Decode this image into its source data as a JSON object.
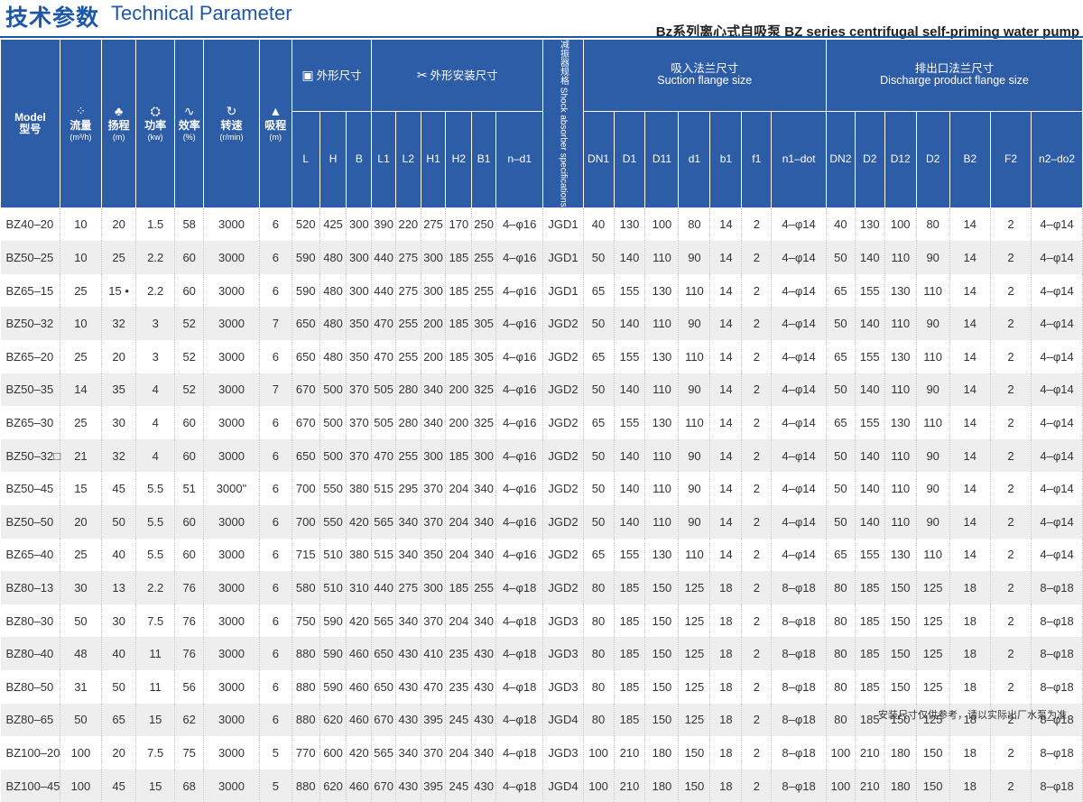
{
  "header": {
    "title_cn": "技术参数",
    "title_en": "Technical Parameter",
    "subtitle": "Bz系列离心式自吸泵 BZ series centrifugal self-priming water pump"
  },
  "table": {
    "model": {
      "en": "Model",
      "cn": "型号"
    },
    "cols_main": [
      {
        "cn": "流量",
        "unit": "(m³/h)",
        "icon": "drops-icon"
      },
      {
        "cn": "扬程",
        "unit": "(m)",
        "icon": "pump-icon"
      },
      {
        "cn": "功率",
        "unit": "(kw)",
        "icon": "motor-icon"
      },
      {
        "cn": "效率",
        "unit": "(%)",
        "icon": "wave-icon"
      },
      {
        "cn": "转速",
        "unit": "(r/min)",
        "icon": "rotate-icon"
      },
      {
        "cn": "吸程",
        "unit": "(m)",
        "icon": "suction-icon"
      }
    ],
    "group_dim": "外形尺寸",
    "group_install": "外形安装尺寸",
    "shock_absorber": "减振器规格 Shock absorber specifications",
    "suction_cn": "吸入法兰尺寸",
    "suction_en": "Suction flange size",
    "discharge_cn": "排出口法兰尺寸",
    "discharge_en": "Discharge product flange size",
    "sub_dim": [
      "L",
      "H",
      "B"
    ],
    "sub_install": [
      "L1",
      "L2",
      "H1",
      "H2",
      "B1",
      "n–d1"
    ],
    "sub_suction": [
      "DN1",
      "D1",
      "D11",
      "d1",
      "b1",
      "f1",
      "n1–dot"
    ],
    "sub_discharge": [
      "DN2",
      "D2",
      "D12",
      "D2",
      "B2",
      "F2",
      "n2–do2"
    ],
    "rows": [
      [
        "BZ40–20",
        "10",
        "20",
        "1.5",
        "58",
        "3000",
        "6",
        "520",
        "425",
        "300",
        "390",
        "220",
        "275",
        "170",
        "250",
        "4–φ16",
        "JGD1",
        "40",
        "130",
        "100",
        "80",
        "14",
        "2",
        "4–φ14",
        "40",
        "130",
        "100",
        "80",
        "14",
        "2",
        "4–φ14"
      ],
      [
        "BZ50–25",
        "10",
        "25",
        "2.2",
        "60",
        "3000",
        "6",
        "590",
        "480",
        "300",
        "440",
        "275",
        "300",
        "185",
        "255",
        "4–φ16",
        "JGD1",
        "50",
        "140",
        "110",
        "90",
        "14",
        "2",
        "4–φ14",
        "50",
        "140",
        "110",
        "90",
        "14",
        "2",
        "4–φ14"
      ],
      [
        "BZ65–15",
        "25",
        "15 •",
        "2.2",
        "60",
        "3000",
        "6",
        "590",
        "480",
        "300",
        "440",
        "275",
        "300",
        "185",
        "255",
        "4–φ16",
        "JGD1",
        "65",
        "155",
        "130",
        "110",
        "14",
        "2",
        "4–φ14",
        "65",
        "155",
        "130",
        "110",
        "14",
        "2",
        "4–φ14"
      ],
      [
        "BZ50–32",
        "10",
        "32",
        "3",
        "52",
        "3000",
        "7",
        "650",
        "480",
        "350",
        "470",
        "255",
        "200",
        "185",
        "305",
        "4–φ16",
        "JGD2",
        "50",
        "140",
        "110",
        "90",
        "14",
        "2",
        "4–φ14",
        "50",
        "140",
        "110",
        "90",
        "14",
        "2",
        "4–φ14"
      ],
      [
        "BZ65–20",
        "25",
        "20",
        "3",
        "52",
        "3000",
        "6",
        "650",
        "480",
        "350",
        "470",
        "255",
        "200",
        "185",
        "305",
        "4–φ16",
        "JGD2",
        "65",
        "155",
        "130",
        "110",
        "14",
        "2",
        "4–φ14",
        "65",
        "155",
        "130",
        "110",
        "14",
        "2",
        "4–φ14"
      ],
      [
        "BZ50–35",
        "14",
        "35",
        "4",
        "52",
        "3000",
        "7",
        "670",
        "500",
        "370",
        "505",
        "280",
        "340",
        "200",
        "325",
        "4–φ16",
        "JGD2",
        "50",
        "140",
        "110",
        "90",
        "14",
        "2",
        "4–φ14",
        "50",
        "140",
        "110",
        "90",
        "14",
        "2",
        "4–φ14"
      ],
      [
        "BZ65–30",
        "25",
        "30",
        "4",
        "60",
        "3000",
        "6",
        "670",
        "500",
        "370",
        "505",
        "280",
        "340",
        "200",
        "325",
        "4–φ16",
        "JGD2",
        "65",
        "155",
        "130",
        "110",
        "14",
        "2",
        "4–φ14",
        "65",
        "155",
        "130",
        "110",
        "14",
        "2",
        "4–φ14"
      ],
      [
        "BZ50–32□",
        "21",
        "32",
        "4",
        "60",
        "3000",
        "6",
        "650",
        "500",
        "370",
        "470",
        "255",
        "300",
        "185",
        "300",
        "4–φ16",
        "JGD2",
        "50",
        "140",
        "110",
        "90",
        "14",
        "2",
        "4–φ14",
        "50",
        "140",
        "110",
        "90",
        "14",
        "2",
        "4–φ14"
      ],
      [
        "BZ50–45",
        "15",
        "45",
        "5.5",
        "51",
        "3000\"",
        "6",
        "700",
        "550",
        "380",
        "515",
        "295",
        "370",
        "204",
        "340",
        "4–φ16",
        "JGD2",
        "50",
        "140",
        "110",
        "90",
        "14",
        "2",
        "4–φ14",
        "50",
        "140",
        "110",
        "90",
        "14",
        "2",
        "4–φ14"
      ],
      [
        "BZ50–50",
        "20",
        "50",
        "5.5",
        "60",
        "3000",
        "6",
        "700",
        "550",
        "420",
        "565",
        "340",
        "370",
        "204",
        "340",
        "4–φ16",
        "JGD2",
        "50",
        "140",
        "110",
        "90",
        "14",
        "2",
        "4–φ14",
        "50",
        "140",
        "110",
        "90",
        "14",
        "2",
        "4–φ14"
      ],
      [
        "BZ65–40",
        "25",
        "40",
        "5.5",
        "60",
        "3000",
        "6",
        "715",
        "510",
        "380",
        "515",
        "340",
        "350",
        "204",
        "340",
        "4–φ16",
        "JGD2",
        "65",
        "155",
        "130",
        "110",
        "14",
        "2",
        "4–φ14",
        "65",
        "155",
        "130",
        "110",
        "14",
        "2",
        "4–φ14"
      ],
      [
        "BZ80–13",
        "30",
        "13",
        "2.2",
        "76",
        "3000",
        "6",
        "580",
        "510",
        "310",
        "440",
        "275",
        "300",
        "185",
        "255",
        "4–φ18",
        "JGD2",
        "80",
        "185",
        "150",
        "125",
        "18",
        "2",
        "8–φ18",
        "80",
        "185",
        "150",
        "125",
        "18",
        "2",
        "8–φ18"
      ],
      [
        "BZ80–30",
        "50",
        "30",
        "7.5",
        "76",
        "3000",
        "6",
        "750",
        "590",
        "420",
        "565",
        "340",
        "370",
        "204",
        "340",
        "4–φ18",
        "JGD3",
        "80",
        "185",
        "150",
        "125",
        "18",
        "2",
        "8–φ18",
        "80",
        "185",
        "150",
        "125",
        "18",
        "2",
        "8–φ18"
      ],
      [
        "BZ80–40",
        "48",
        "40",
        "11",
        "76",
        "3000",
        "6",
        "880",
        "590",
        "460",
        "650",
        "430",
        "410",
        "235",
        "430",
        "4–φ18",
        "JGD3",
        "80",
        "185",
        "150",
        "125",
        "18",
        "2",
        "8–φ18",
        "80",
        "185",
        "150",
        "125",
        "18",
        "2",
        "8–φ18"
      ],
      [
        "BZ80–50",
        "31",
        "50",
        "11",
        "56",
        "3000",
        "6",
        "880",
        "590",
        "460",
        "650",
        "430",
        "470",
        "235",
        "430",
        "4–φ18",
        "JGD3",
        "80",
        "185",
        "150",
        "125",
        "18",
        "2",
        "8–φ18",
        "80",
        "185",
        "150",
        "125",
        "18",
        "2",
        "8–φ18"
      ],
      [
        "BZ80–65",
        "50",
        "65",
        "15",
        "62",
        "3000",
        "6",
        "880",
        "620",
        "460",
        "670",
        "430",
        "395",
        "245",
        "430",
        "4–φ18",
        "JGD4",
        "80",
        "185",
        "150",
        "125",
        "18",
        "2",
        "8–φ18",
        "80",
        "185",
        "150",
        "125",
        "18",
        "2",
        "8–φ18"
      ],
      [
        "BZ100–20",
        "100",
        "20",
        "7.5",
        "75",
        "3000",
        "5",
        "770",
        "600",
        "420",
        "565",
        "340",
        "370",
        "204",
        "340",
        "4–φ18",
        "JGD3",
        "100",
        "210",
        "180",
        "150",
        "18",
        "2",
        "8–φ18",
        "100",
        "210",
        "180",
        "150",
        "18",
        "2",
        "8–φ18"
      ],
      [
        "BZ100–45",
        "100",
        "45",
        "15",
        "68",
        "3000",
        "5",
        "880",
        "620",
        "460",
        "670",
        "430",
        "395",
        "245",
        "430",
        "4–φ18",
        "JGD4",
        "100",
        "210",
        "180",
        "150",
        "18",
        "2",
        "8–φ18",
        "100",
        "210",
        "180",
        "150",
        "18",
        "2",
        "8–φ18"
      ]
    ]
  },
  "footnote": "安装尺寸仅供参考，请以实际出厂水泵为准"
}
